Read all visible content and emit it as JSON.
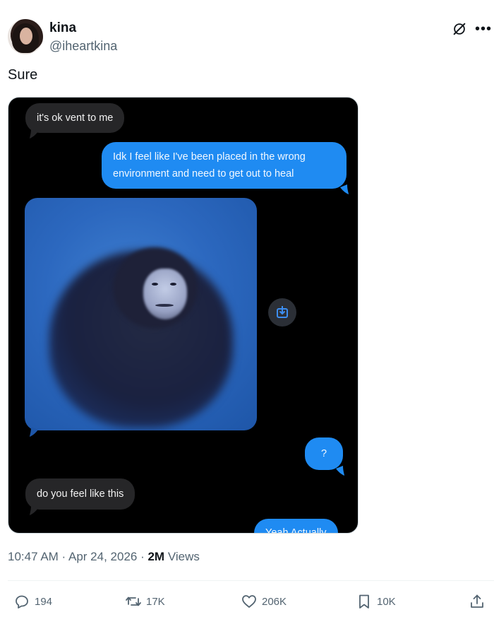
{
  "author": {
    "name": "kina",
    "handle": "@iheartkina"
  },
  "tweet": {
    "text": "Sure"
  },
  "media": {
    "messages": [
      {
        "from": "them",
        "text": "it's ok vent to me"
      },
      {
        "from": "me",
        "text": "Idk I feel like I've been placed in the wrong environment and need to get out to heal"
      },
      {
        "from": "them",
        "type": "image",
        "image_desc": "gorilla-underwater"
      },
      {
        "from": "me",
        "text": "?"
      },
      {
        "from": "them",
        "text": "do you feel like this"
      },
      {
        "from": "me",
        "text": "Yeah Actually"
      }
    ]
  },
  "meta": {
    "time": "10:47 AM",
    "date": "Apr 24, 2026",
    "views_count": "2M",
    "views_label": "Views"
  },
  "actions": {
    "replies": "194",
    "reposts": "17K",
    "likes": "206K",
    "bookmarks": "10K"
  },
  "colors": {
    "bubble_blue": "#1f8bf2",
    "bubble_gray": "#262628",
    "secondary_text": "#536471"
  }
}
